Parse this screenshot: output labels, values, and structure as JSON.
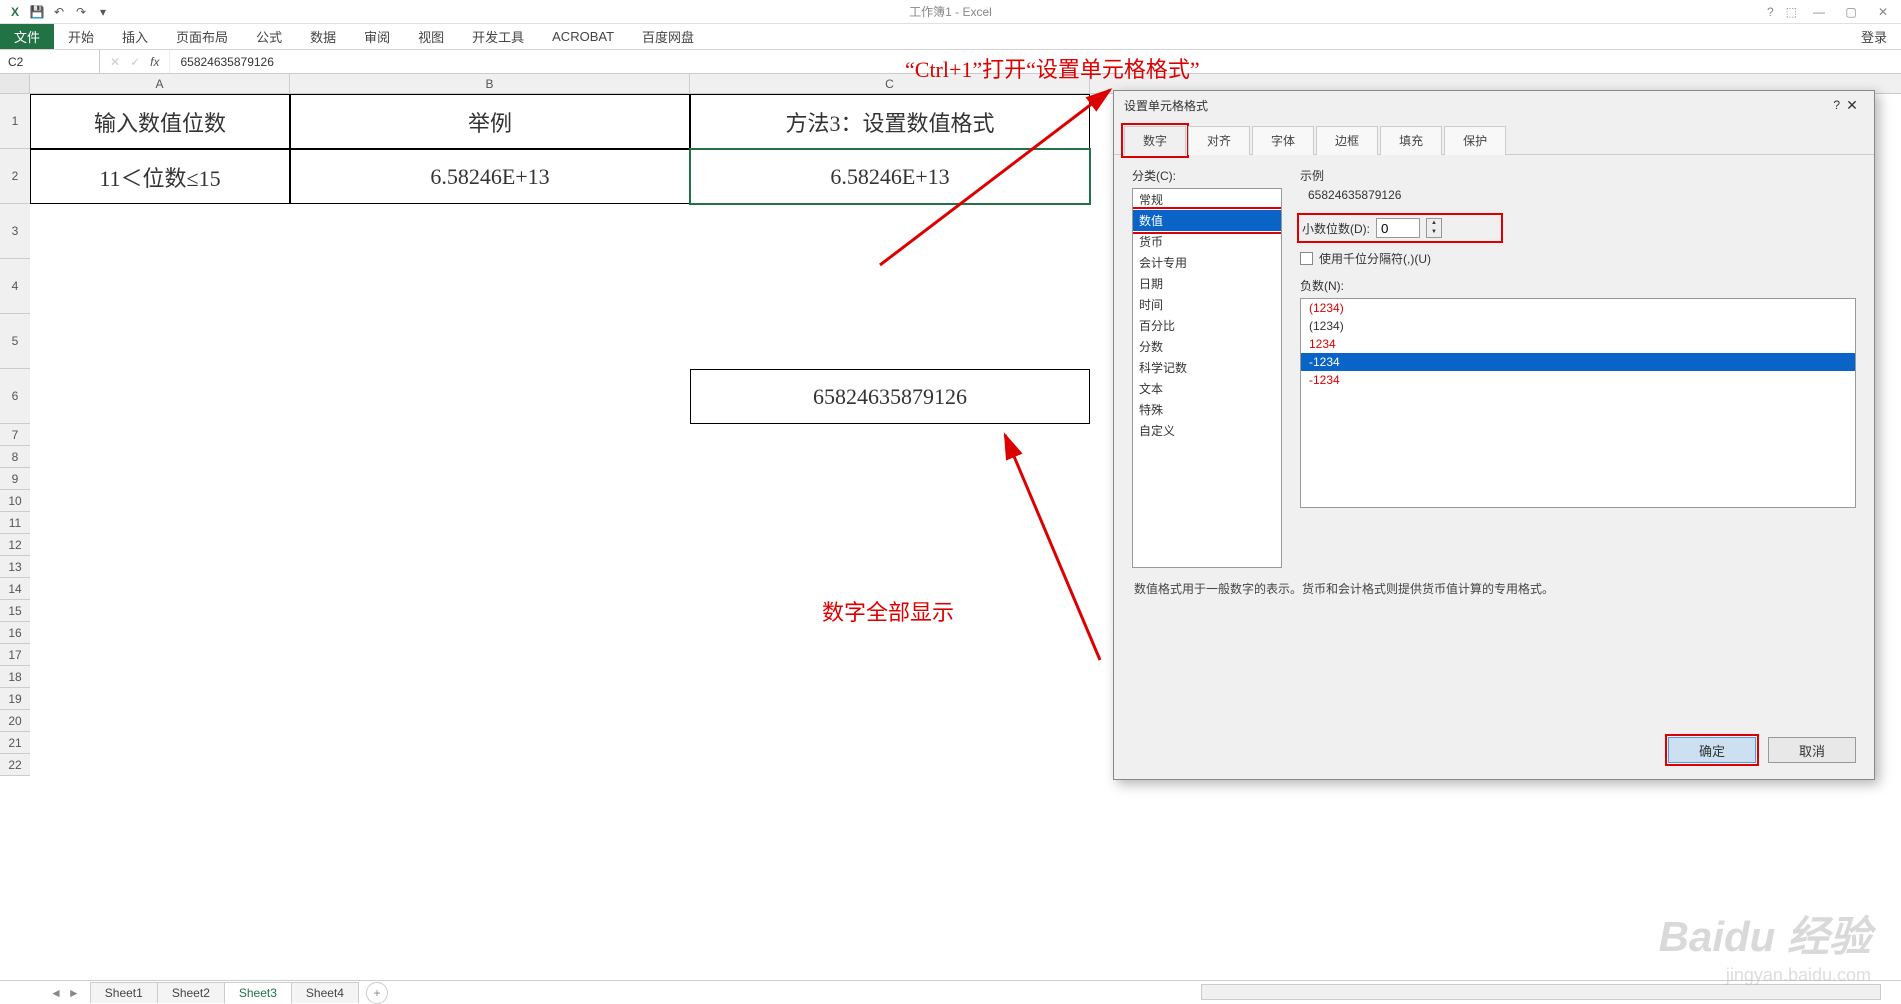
{
  "title": "工作簿1 - Excel",
  "login": "登录",
  "ribbon": {
    "file": "文件",
    "tabs": [
      "开始",
      "插入",
      "页面布局",
      "公式",
      "数据",
      "审阅",
      "视图",
      "开发工具",
      "ACROBAT",
      "百度网盘"
    ]
  },
  "namebox": "C2",
  "formula": "65824635879126",
  "cols": [
    "A",
    "B",
    "C"
  ],
  "rows": [
    "1",
    "2",
    "3",
    "4",
    "5",
    "6",
    "7",
    "8",
    "9",
    "10",
    "11",
    "12",
    "13",
    "14",
    "15",
    "16",
    "17",
    "18",
    "19",
    "20",
    "21",
    "22"
  ],
  "cells": {
    "A1": "输入数值位数",
    "B1": "举例",
    "C1": "方法3：设置数值格式",
    "A2": "11＜位数≤15",
    "B2": "6.58246E+13",
    "C2": "6.58246E+13",
    "C6": "65824635879126"
  },
  "anno": {
    "top": "“Ctrl+1”打开“设置单元格格式”",
    "mid": "数字全部显示"
  },
  "dialog": {
    "title": "设置单元格格式",
    "tabs": [
      "数字",
      "对齐",
      "字体",
      "边框",
      "填充",
      "保护"
    ],
    "cat_label": "分类(C):",
    "cats": [
      "常规",
      "数值",
      "货币",
      "会计专用",
      "日期",
      "时间",
      "百分比",
      "分数",
      "科学记数",
      "文本",
      "特殊",
      "自定义"
    ],
    "sample_label": "示例",
    "sample_value": "65824635879126",
    "dec_label": "小数位数(D):",
    "dec_value": "0",
    "sep_label": "使用千位分隔符(,)(U)",
    "neg_label": "负数(N):",
    "neg_items": [
      {
        "t": "(1234)",
        "red": true
      },
      {
        "t": "(1234)",
        "red": false
      },
      {
        "t": "1234",
        "red": true
      },
      {
        "t": "-1234",
        "sel": true
      },
      {
        "t": "-1234",
        "red": true
      }
    ],
    "desc": "数值格式用于一般数字的表示。货币和会计格式则提供货币值计算的专用格式。",
    "ok": "确定",
    "cancel": "取消"
  },
  "sheets": [
    "Sheet1",
    "Sheet2",
    "Sheet3",
    "Sheet4"
  ],
  "active_sheet": 2,
  "watermark": "Baidu 经验",
  "watermark2": "jingyan.baidu.com"
}
